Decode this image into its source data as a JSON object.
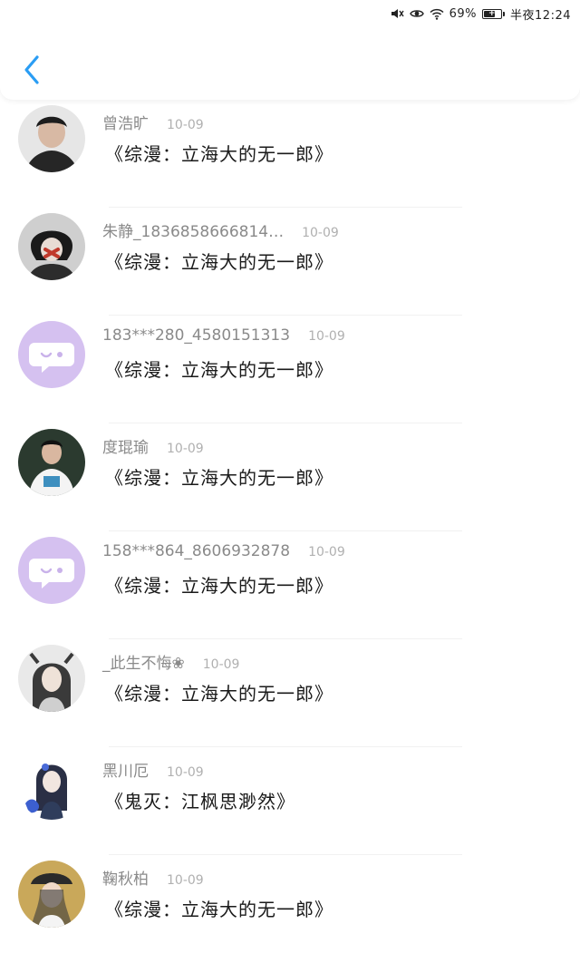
{
  "status_bar": {
    "battery": "69%",
    "time": "半夜12:24",
    "battery_level": 0.69
  },
  "header": {
    "back_icon": "chevron-left-icon",
    "accent_color": "#2a9df4"
  },
  "items": [
    {
      "name": "曾浩旷",
      "date": "10-09",
      "title": "《综漫：立海大的无一郎》",
      "avatar": "photo"
    },
    {
      "name": "朱静_1836858666814…",
      "date": "10-09",
      "title": "《综漫：立海大的无一郎》",
      "avatar": "photo"
    },
    {
      "name": "183***280_4580151313",
      "date": "10-09",
      "title": "《综漫：立海大的无一郎》",
      "avatar": "default-chat-icon"
    },
    {
      "name": "度琨瑜",
      "date": "10-09",
      "title": "《综漫：立海大的无一郎》",
      "avatar": "photo"
    },
    {
      "name": "158***864_8606932878",
      "date": "10-09",
      "title": "《综漫：立海大的无一郎》",
      "avatar": "default-chat-icon"
    },
    {
      "name": "_此生不悔❀",
      "date": "10-09",
      "title": "《综漫：立海大的无一郎》",
      "avatar": "photo"
    },
    {
      "name": "黑川厄",
      "date": "10-09",
      "title": "《鬼灭：江枫思渺然》",
      "avatar": "photo"
    },
    {
      "name": "鞠秋柏",
      "date": "10-09",
      "title": "《综漫：立海大的无一郎》",
      "avatar": "photo"
    }
  ]
}
